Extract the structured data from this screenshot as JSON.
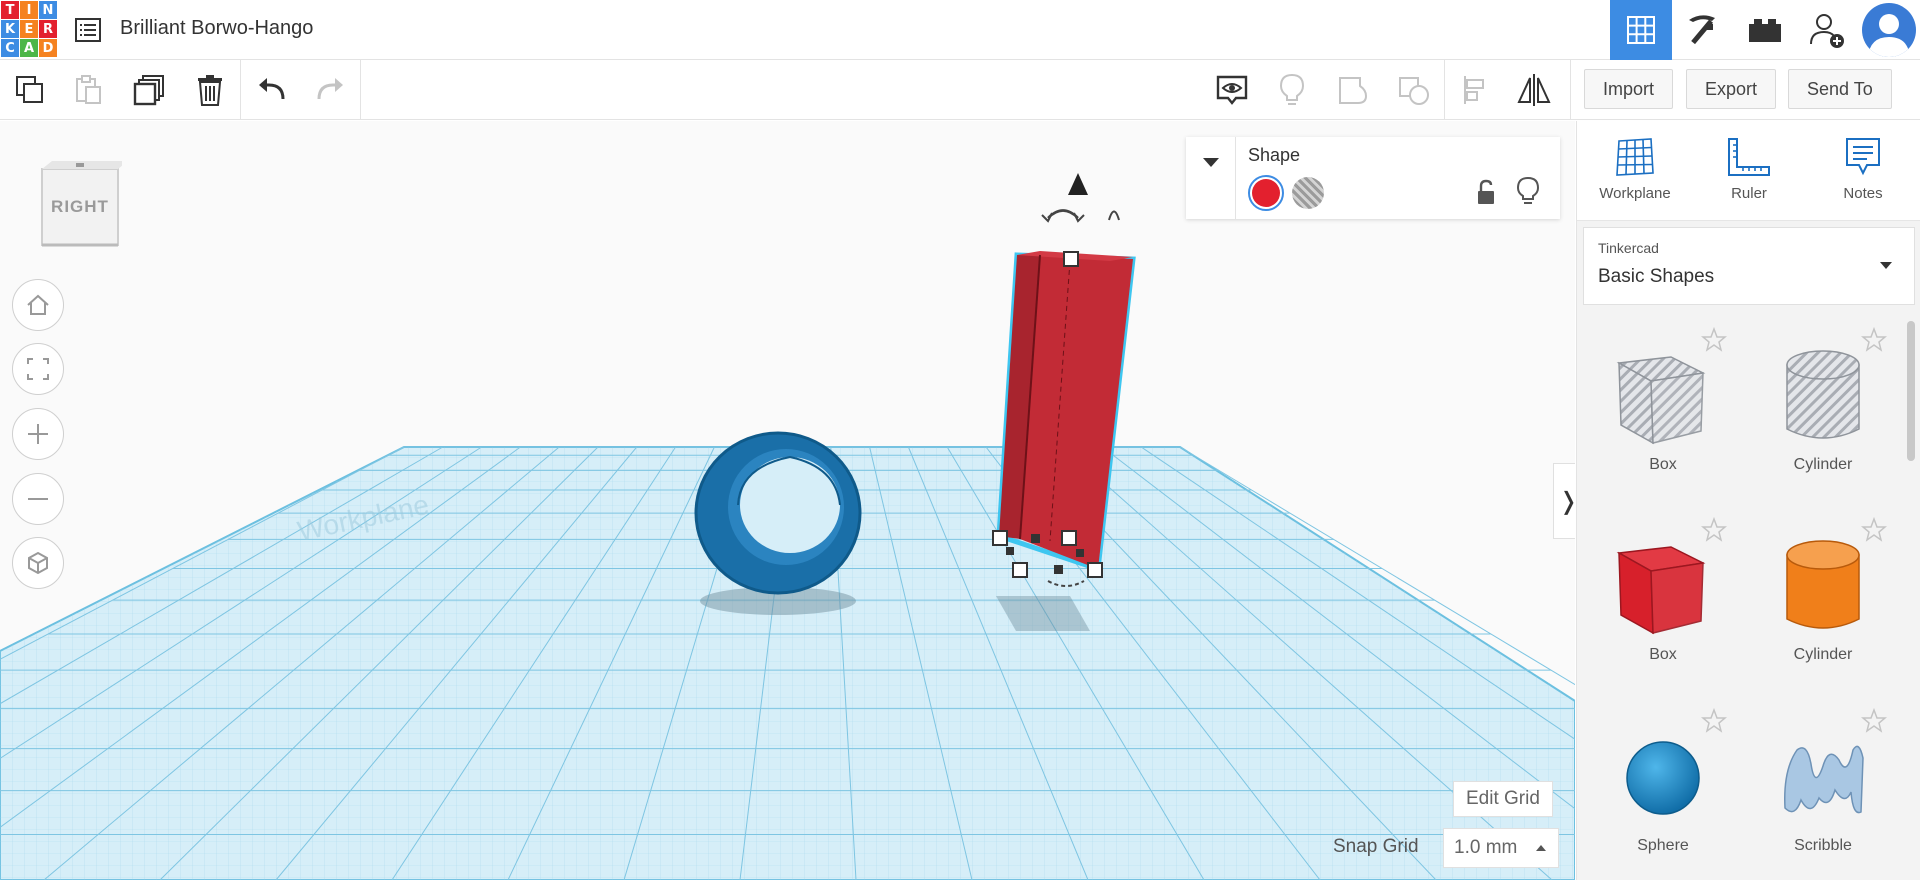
{
  "app": {
    "logo_letters": [
      "T",
      "I",
      "N",
      "K",
      "E",
      "R",
      "C",
      "A",
      "D"
    ],
    "logo_colors": [
      "#e3202e",
      "#f58220",
      "#3d8ce3",
      "#3d8ce3",
      "#f58220",
      "#e3202e",
      "#3d8ce3",
      "#4cb648",
      "#f58220"
    ],
    "project_title": "Brilliant Borwo-Hango"
  },
  "top_nav": {
    "items": [
      {
        "icon": "grid-view-icon",
        "active": true
      },
      {
        "icon": "pickaxe-icon",
        "active": false
      },
      {
        "icon": "bricks-icon",
        "active": false
      },
      {
        "icon": "add-user-icon",
        "active": false
      },
      {
        "icon": "avatar-icon",
        "active": false
      }
    ]
  },
  "toolbar": {
    "left_tools": [
      "copy-icon",
      "paste-icon",
      "duplicate-icon",
      "delete-icon",
      "undo-icon",
      "redo-icon"
    ],
    "right_tools": [
      "show-notes-icon",
      "bulb-icon",
      "group-icon",
      "ungroup-icon",
      "align-icon",
      "mirror-icon"
    ],
    "import_label": "Import",
    "export_label": "Export",
    "send_to_label": "Send To"
  },
  "viewcube": {
    "face_label": "RIGHT"
  },
  "view_controls": [
    "home-icon",
    "fit-view-icon",
    "zoom-in-icon",
    "zoom-out-icon",
    "perspective-icon"
  ],
  "shape_panel": {
    "title": "Shape",
    "solid_color": "#e3202e"
  },
  "grid": {
    "edit_grid_label": "Edit Grid",
    "snap_grid_label": "Snap Grid",
    "snap_value": "1.0 mm"
  },
  "right_panel": {
    "tools": [
      {
        "label": "Workplane",
        "icon": "workplane-icon"
      },
      {
        "label": "Ruler",
        "icon": "ruler-icon"
      },
      {
        "label": "Notes",
        "icon": "notes-icon"
      }
    ],
    "library_source": "Tinkercad",
    "library_name": "Basic Shapes",
    "shapes": [
      {
        "name": "Box",
        "kind": "box-hole",
        "color": "#c9ccd1"
      },
      {
        "name": "Cylinder",
        "kind": "cylinder-hole",
        "color": "#c9ccd1"
      },
      {
        "name": "Box",
        "kind": "box",
        "color": "#d7202b"
      },
      {
        "name": "Cylinder",
        "kind": "cylinder",
        "color": "#f07f1a"
      },
      {
        "name": "Sphere",
        "kind": "sphere",
        "color": "#1f8fcf"
      },
      {
        "name": "Scribble",
        "kind": "scribble",
        "color": "#a9c7e3"
      }
    ]
  },
  "colors": {
    "accent": "#3d8ce3",
    "workplane": "#cfeaf6",
    "grid_line": "#7ec5e2",
    "torus": "#1a6fa8",
    "selected_box": "#c22b36"
  }
}
